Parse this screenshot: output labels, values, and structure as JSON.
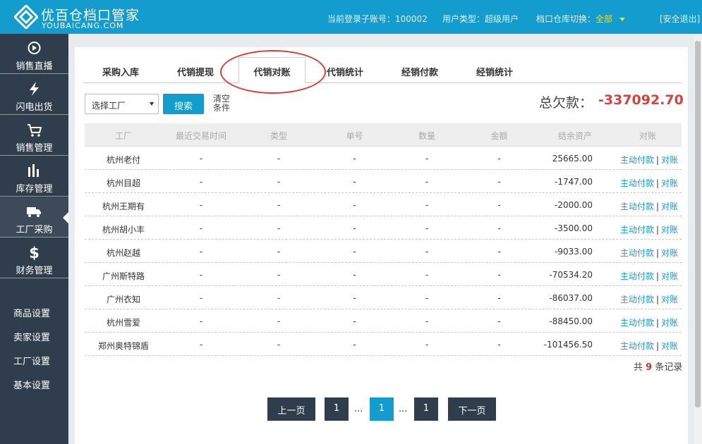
{
  "header": {
    "brand_cn": "优百仓档口管家",
    "brand_en": "YOUBAICANG.COM",
    "account_label": "当前登录子账号：",
    "account_value": "100002",
    "user_type_label": "用户类型：",
    "user_type_value": "超级用户",
    "warehouse_label": "档口仓库切换：",
    "warehouse_value": "全部",
    "logout": "[安全退出]"
  },
  "sidebar": {
    "items": [
      {
        "label": "销售直播",
        "icon": "play-circle-icon"
      },
      {
        "label": "闪电出货",
        "icon": "lightning-icon"
      },
      {
        "label": "销售管理",
        "icon": "cart-icon"
      },
      {
        "label": "库存管理",
        "icon": "bar-chart-icon"
      },
      {
        "label": "工厂采购",
        "icon": "truck-icon"
      },
      {
        "label": "财务管理",
        "icon": "dollar-icon"
      }
    ],
    "links": [
      "商品设置",
      "卖家设置",
      "工厂设置",
      "基本设置"
    ]
  },
  "tabs": [
    "采购入库",
    "代销提现",
    "代销对账",
    "代销统计",
    "经销付款",
    "经销统计"
  ],
  "filter": {
    "select_value": "选择工厂",
    "search_button": "搜索",
    "clear_line1": "清空",
    "clear_line2": "条件"
  },
  "debt": {
    "label": "总欠款：",
    "value": "-337092.70"
  },
  "table": {
    "headers": [
      "工厂",
      "最近交易时间",
      "类型",
      "单号",
      "数量",
      "金额",
      "结余资产",
      "对账"
    ],
    "rows": [
      {
        "factory": "杭州老付",
        "time": "-",
        "type": "-",
        "no": "-",
        "qty": "-",
        "amount": "-",
        "balance": "25665.00"
      },
      {
        "factory": "杭州目超",
        "time": "-",
        "type": "-",
        "no": "-",
        "qty": "-",
        "amount": "-",
        "balance": "-1747.00"
      },
      {
        "factory": "杭州王期有",
        "time": "-",
        "type": "-",
        "no": "-",
        "qty": "-",
        "amount": "-",
        "balance": "-2000.00"
      },
      {
        "factory": "杭州胡小丰",
        "time": "-",
        "type": "-",
        "no": "-",
        "qty": "-",
        "amount": "-",
        "balance": "-3500.00"
      },
      {
        "factory": "杭州赵越",
        "time": "-",
        "type": "-",
        "no": "-",
        "qty": "-",
        "amount": "-",
        "balance": "-9033.00"
      },
      {
        "factory": "广州斯特路",
        "time": "-",
        "type": "-",
        "no": "-",
        "qty": "-",
        "amount": "-",
        "balance": "-70534.20"
      },
      {
        "factory": "广州衣知",
        "time": "-",
        "type": "-",
        "no": "-",
        "qty": "-",
        "amount": "-",
        "balance": "-86037.00"
      },
      {
        "factory": "杭州雪爱",
        "time": "-",
        "type": "-",
        "no": "-",
        "qty": "-",
        "amount": "-",
        "balance": "-88450.00"
      },
      {
        "factory": "郑州奥特锦盾",
        "time": "-",
        "type": "-",
        "no": "-",
        "qty": "-",
        "amount": "-",
        "balance": "-101456.50"
      }
    ],
    "action_pay": "主动付款",
    "action_sep": "|",
    "action_reconcile": "对账"
  },
  "summary": {
    "prefix": "共",
    "count": "9",
    "suffix": "条记录"
  },
  "pagination": {
    "prev": "上一页",
    "first": "1",
    "dots": "...",
    "current": "1",
    "last": "1",
    "next": "下一页"
  }
}
